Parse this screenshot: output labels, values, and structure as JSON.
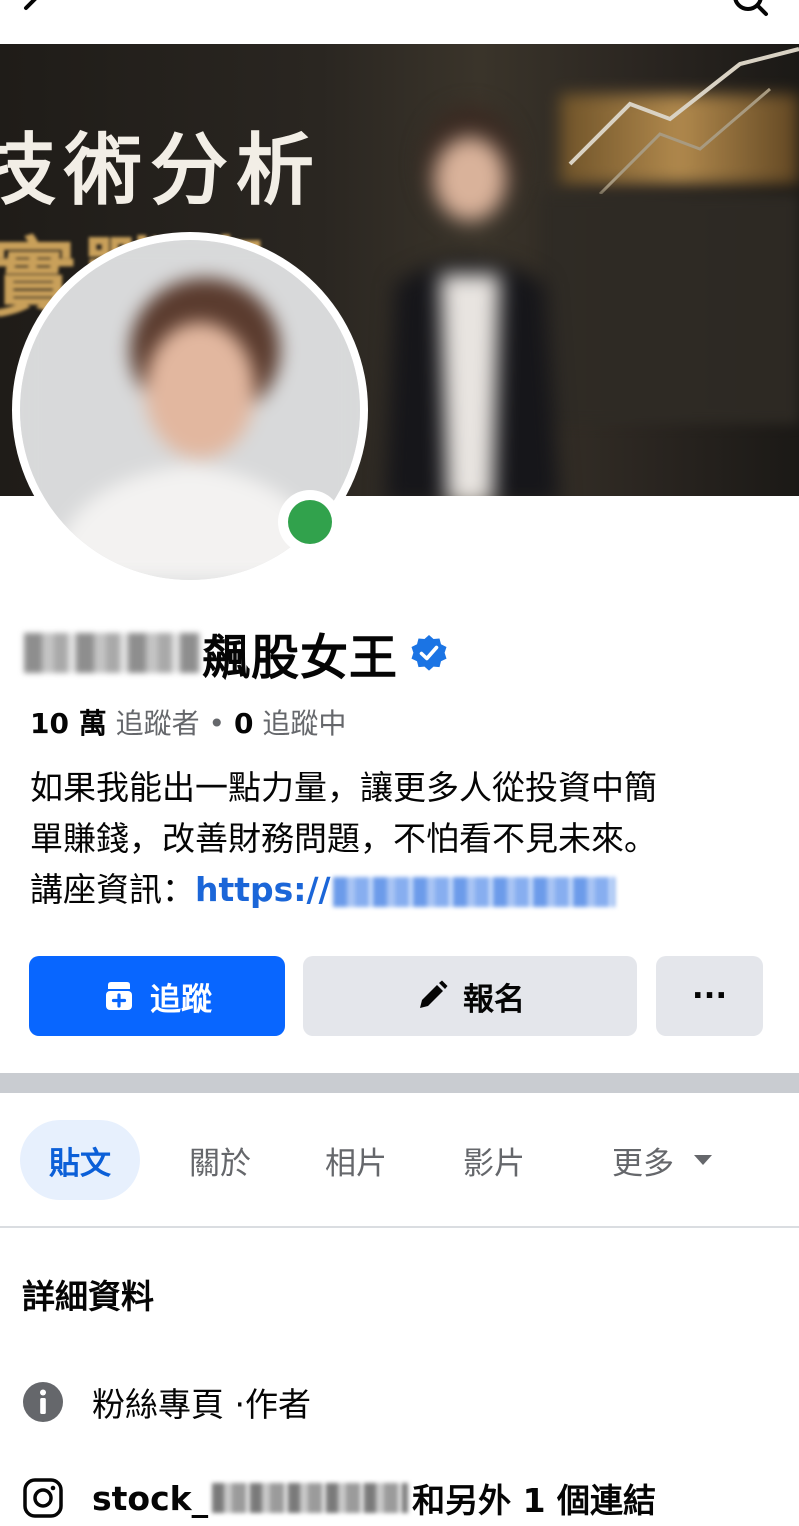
{
  "profile": {
    "name": "飆股女王",
    "followers_count": "10 萬",
    "followers_label": "追蹤者",
    "following_count": "0",
    "following_label": "追蹤中",
    "bio_line1": "如果我能出一點力量，讓更多人從投資中簡",
    "bio_line2": "單賺錢，改善財務問題，不怕看不見未來。",
    "bio_line3_prefix": "講座資訊：",
    "bio_link_visible": "https://",
    "online": true,
    "verified": true
  },
  "cover": {
    "title_line1": "技術分析",
    "title_line2": "實戰班"
  },
  "actions": {
    "follow_label": "追蹤",
    "register_label": "報名",
    "more_label": "···"
  },
  "tabs": [
    {
      "label": "貼文",
      "active": true
    },
    {
      "label": "關於",
      "active": false
    },
    {
      "label": "相片",
      "active": false
    },
    {
      "label": "影片",
      "active": false
    },
    {
      "label": "更多",
      "active": false
    }
  ],
  "details": {
    "title": "詳細資料",
    "category_prefix": "粉絲專頁 · ",
    "category": "作者",
    "instagram_prefix": "stock_",
    "instagram_suffix": "和另外 1 個連結"
  },
  "icons": {
    "back": "back-arrow-icon",
    "search": "search-icon",
    "verified": "verified-badge-icon",
    "follow": "follow-icon",
    "register": "pencil-icon",
    "more": "more-dots-icon",
    "tab_more": "caret-down-icon",
    "info": "info-icon",
    "instagram": "instagram-icon"
  },
  "colors": {
    "primary": "#0866ff",
    "verified": "#1b74e4",
    "online": "#31a24c",
    "active_tab_bg": "#e7f0fd",
    "link": "#1b66d8"
  }
}
